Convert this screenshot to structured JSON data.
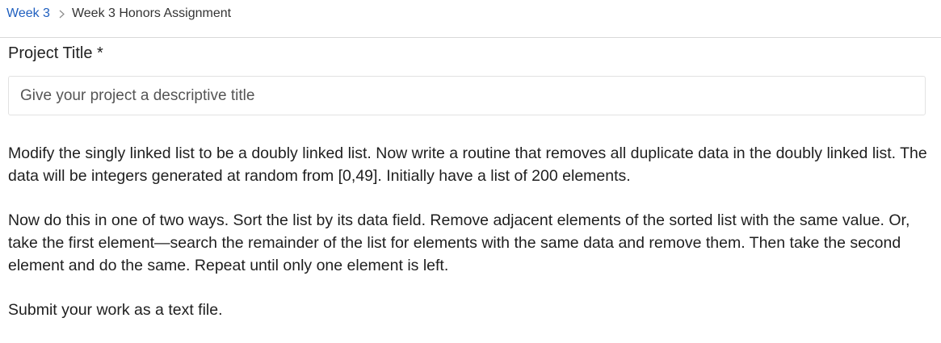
{
  "breadcrumb": {
    "parent": "Week 3",
    "separator_icon": "chevron-right-icon",
    "current": "Week 3 Honors Assignment"
  },
  "form": {
    "title_label": "Project Title *",
    "title_placeholder": "Give your project a descriptive title"
  },
  "instructions": {
    "paragraphs": [
      "Modify the singly linked list to be a doubly linked list. Now write a routine that removes all duplicate data in the doubly linked list. The data will be integers generated at random from [0,49]. Initially have a list of 200 elements.",
      "Now do this in one of two ways.  Sort the list by its data field. Remove adjacent elements of the sorted list with the same value. Or, take the first element—search the remainder of the list for elements with the same data and remove them. Then take the second element and do the same. Repeat until only one element is left.",
      "Submit your work as a text file."
    ]
  },
  "colors": {
    "link": "#1f5fbf",
    "text": "#1f1f1f",
    "border": "#e2e2e2"
  }
}
